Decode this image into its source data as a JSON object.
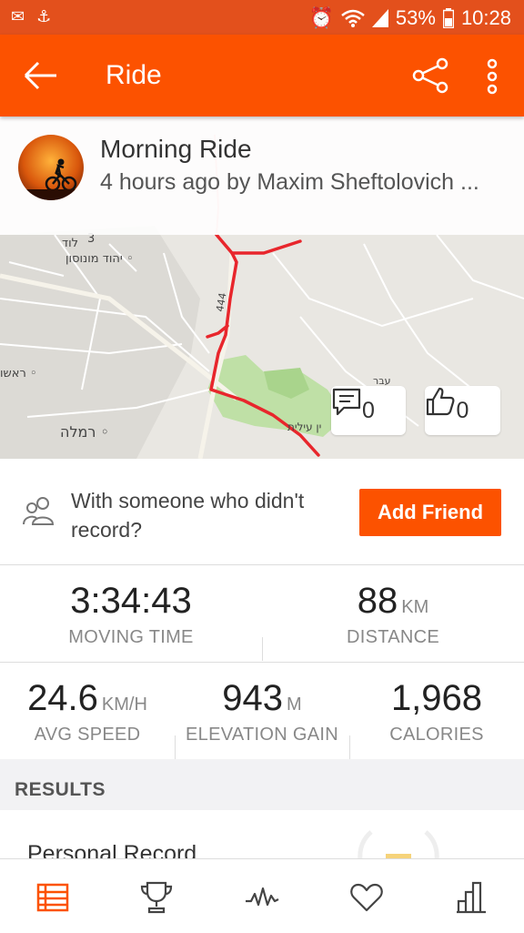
{
  "status_bar": {
    "left_icons": [
      "voicemail-icon",
      "usb-icon"
    ],
    "battery": "53%",
    "time": "10:28"
  },
  "app_bar": {
    "title": "Ride",
    "icons": [
      "back-arrow-icon",
      "share-icon",
      "more-vert-icon"
    ]
  },
  "activity": {
    "title": "Morning Ride",
    "subtitle": "4 hours ago by Maxim Sheftolovich ...",
    "comments_count": "0",
    "kudos_count": "0"
  },
  "map": {
    "labels": [
      "לוד",
      "3",
      "יהוד מונוסון",
      "ראשו",
      "רמלה",
      "444",
      "ין עילית",
      "עבר"
    ],
    "route_color": "#e8262c"
  },
  "friend_prompt": {
    "text": "With someone who didn't record?",
    "button": "Add Friend"
  },
  "stats": {
    "moving_time": {
      "value": "3:34:43",
      "label": "MOVING TIME"
    },
    "distance": {
      "value": "88",
      "unit": "KM",
      "label": "DISTANCE"
    },
    "avg_speed": {
      "value": "24.6",
      "unit": "KM/H",
      "label": "AVG SPEED"
    },
    "elevation": {
      "value": "943",
      "unit": "M",
      "label": "ELEVATION GAIN"
    },
    "calories": {
      "value": "1,968",
      "label": "CALORIES"
    }
  },
  "results": {
    "header": "RESULTS",
    "first_item": "Personal Record"
  },
  "bottom_nav": [
    "feed-icon",
    "trophy-icon",
    "activity-pulse-icon",
    "heart-icon",
    "stats-bars-icon"
  ],
  "colors": {
    "brand": "#fc5200",
    "status_bar": "#e3501c"
  }
}
